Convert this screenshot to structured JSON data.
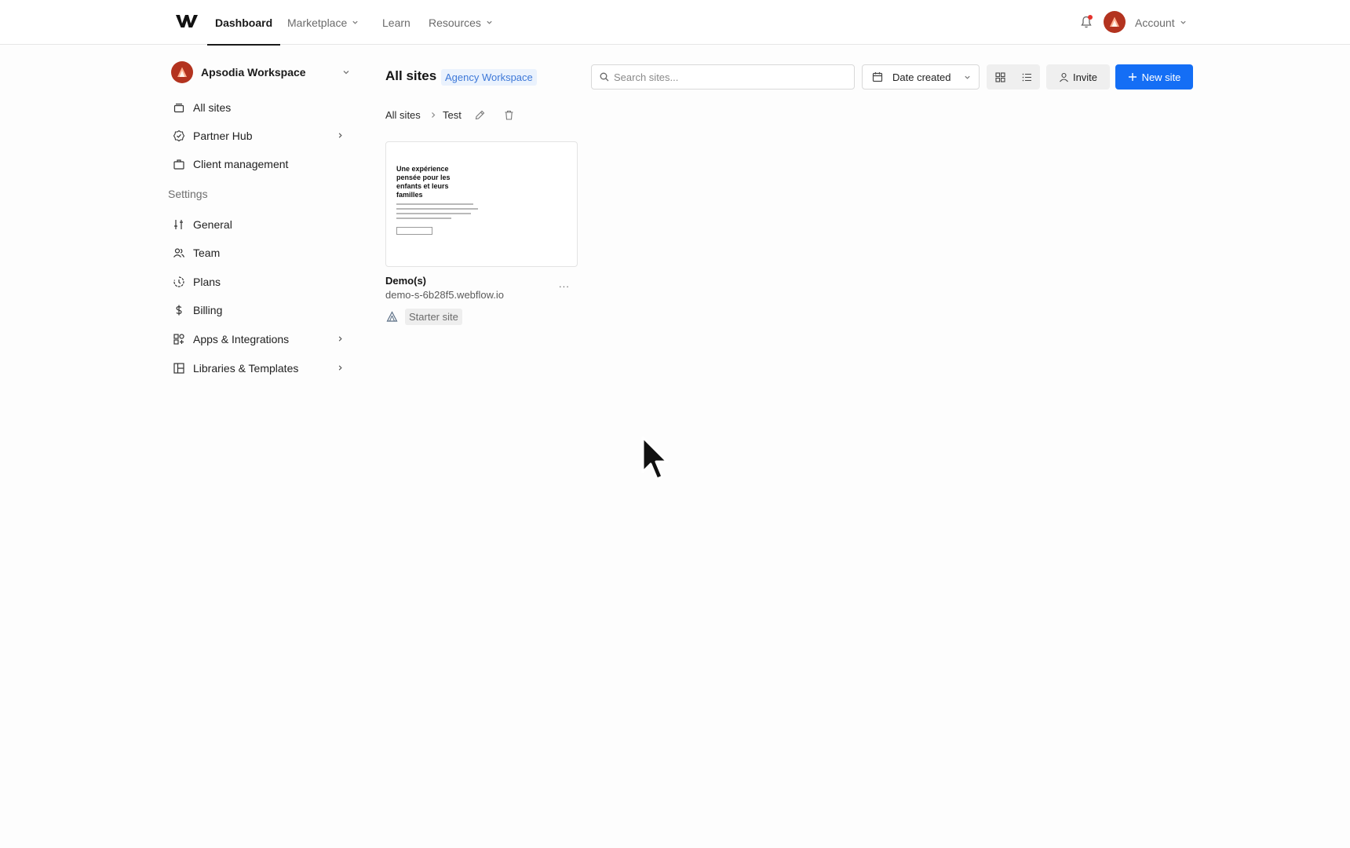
{
  "topnav": {
    "logo_icon": "webflow-logo",
    "items": [
      {
        "label": "Dashboard",
        "active": true
      },
      {
        "label": "Marketplace",
        "dropdown": true
      },
      {
        "label": "Learn"
      },
      {
        "label": "Resources",
        "dropdown": true
      }
    ],
    "account_label": "Account",
    "notification_icon": "bell-icon",
    "has_notification_dot": true
  },
  "sidebar": {
    "workspace_name": "Apsodia Workspace",
    "items": [
      {
        "label": "All sites",
        "icon": "stack-icon"
      },
      {
        "label": "Partner Hub",
        "icon": "badge-check-icon",
        "submenu": true
      },
      {
        "label": "Client management",
        "icon": "briefcase-icon"
      }
    ],
    "settings_heading": "Settings",
    "settings_items": [
      {
        "label": "General",
        "icon": "sliders-icon"
      },
      {
        "label": "Team",
        "icon": "users-icon"
      },
      {
        "label": "Plans",
        "icon": "plans-icon"
      },
      {
        "label": "Billing",
        "icon": "dollar-icon"
      },
      {
        "label": "Apps & Integrations",
        "icon": "apps-icon",
        "submenu": true
      },
      {
        "label": "Libraries & Templates",
        "icon": "library-icon",
        "submenu": true
      }
    ]
  },
  "main": {
    "title": "All sites",
    "workspace_badge": "Agency Workspace",
    "search_placeholder": "Search sites...",
    "sort_label": "Date created",
    "invite_label": "Invite",
    "new_site_label": "New site",
    "breadcrumb": {
      "root": "All sites",
      "current": "Test"
    }
  },
  "sites": [
    {
      "name": "Demo(s)",
      "domain": "demo-s-6b28f5.webflow.io",
      "plan": "Starter site",
      "more_label": "...",
      "thumbnail_title": "Une expérience pensée pour les enfants et leurs familles"
    }
  ],
  "colors": {
    "primary": "#146ef5",
    "avatar": "#b3331f",
    "badge_bg": "#eaf2fd",
    "badge_text": "#3d78d8",
    "notification_dot": "#e5322d"
  }
}
